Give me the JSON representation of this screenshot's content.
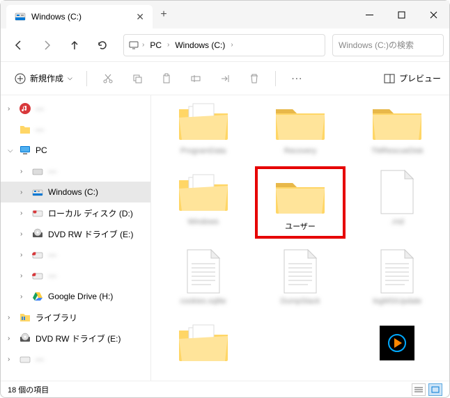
{
  "window": {
    "title": "Windows (C:)"
  },
  "breadcrumb": {
    "seg1": "PC",
    "seg2": "Windows (C:)"
  },
  "search": {
    "placeholder": "Windows (C:)の検索"
  },
  "toolbar": {
    "new_label": "新規作成",
    "preview_label": "プレビュー"
  },
  "sidebar": {
    "items": [
      {
        "label": "—"
      },
      {
        "label": "—"
      },
      {
        "label": "PC"
      },
      {
        "label": "—"
      },
      {
        "label": "Windows (C:)"
      },
      {
        "label": "ローカル ディスク (D:)"
      },
      {
        "label": "DVD RW ドライブ (E:)"
      },
      {
        "label": "—"
      },
      {
        "label": "—"
      },
      {
        "label": "Google Drive (H:)"
      },
      {
        "label": "ライブラリ"
      },
      {
        "label": "DVD RW ドライブ (E:)"
      },
      {
        "label": "—"
      }
    ]
  },
  "main": {
    "items": [
      {
        "label": "ProgramData",
        "type": "folder-docs",
        "blur": true
      },
      {
        "label": "Recovery",
        "type": "folder",
        "blur": true
      },
      {
        "label": "TMRescueDisk",
        "type": "folder",
        "blur": true
      },
      {
        "label": "Windows",
        "type": "folder-docs",
        "blur": true
      },
      {
        "label": "ユーザー",
        "type": "folder",
        "blur": false,
        "highlight": true
      },
      {
        "label": ".rnd",
        "type": "file",
        "blur": true
      },
      {
        "label": "cookies.sqlite",
        "type": "textfile",
        "blur": true
      },
      {
        "label": "DumpStack",
        "type": "textfile",
        "blur": true
      },
      {
        "label": "logMSIUpdate",
        "type": "textfile",
        "blur": true
      },
      {
        "label": "",
        "type": "folder-docs",
        "blur": true
      },
      {
        "label": "",
        "type": "spacer",
        "blur": true
      },
      {
        "label": "",
        "type": "media",
        "blur": false
      }
    ]
  },
  "status": {
    "count": "18 個の項目"
  }
}
